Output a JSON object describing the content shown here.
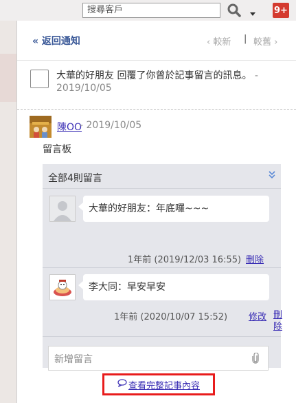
{
  "topbar": {
    "search_placeholder": "搜尋客戶",
    "notif_count": "9+"
  },
  "nav": {
    "back_label": "« 返回通知",
    "newer_label": "‹ 較新",
    "separator": "|",
    "older_label": "較舊 ›"
  },
  "notification": {
    "text": "大華的好朋友 回覆了你曾於記事留言的訊息。",
    "dash": "-",
    "date": "2019/10/05"
  },
  "post": {
    "author": "陳OO",
    "date": "- 2019/10/05",
    "board": "留言板"
  },
  "comments": {
    "header": "全部4則留言",
    "items": [
      {
        "text": "大華的好朋友：年底囉~~~",
        "meta": "1年前 (2019/12/03 16:55)",
        "delete_label": "刪除"
      },
      {
        "text": "李大同：早安早安",
        "meta": "1年前 (2020/10/07 15:52)",
        "edit_label": "修改",
        "delete_label": "刪除"
      }
    ],
    "new_comment_placeholder": "新增留言"
  },
  "view_full_label": "查看完整記事內容"
}
